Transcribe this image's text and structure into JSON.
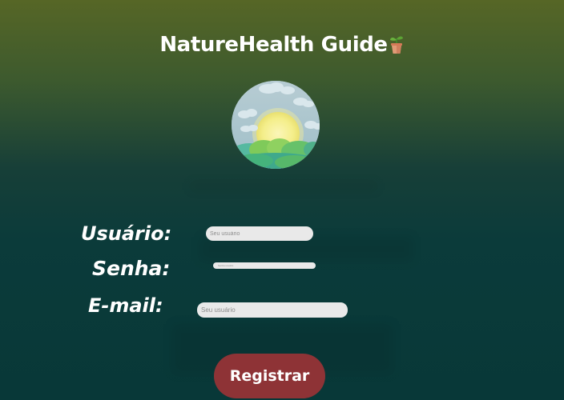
{
  "header": {
    "app_title": "NatureHealth Guide",
    "title_icon": "potted-plant-icon"
  },
  "avatar": {
    "icon": "sunrise-landscape-icon"
  },
  "form": {
    "username": {
      "label": "Usuário:",
      "value": "",
      "placeholder": "Seu usuário"
    },
    "password": {
      "label": "Senha:",
      "value": "",
      "placeholder": "Senha usuário"
    },
    "email": {
      "label": "E-mail:",
      "value": "",
      "placeholder": "Seu usuário"
    },
    "submit_label": "Registrar"
  },
  "colors": {
    "background_top": "#566626",
    "background_bottom": "#083838",
    "button": "#8e3336",
    "input": "#e9e9e9",
    "text": "#ffffff"
  }
}
